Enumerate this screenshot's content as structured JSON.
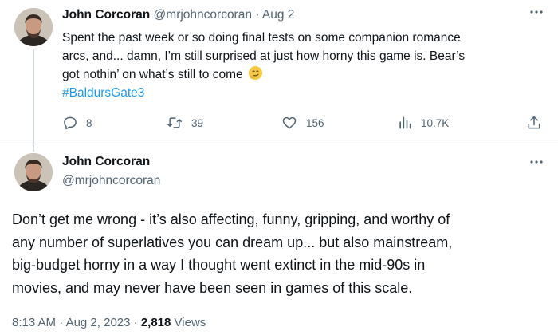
{
  "tweet1": {
    "name": "John Corcoran",
    "handle": "@mrjohncorcoran",
    "separator": "·",
    "date": "Aug 2",
    "text_lines": [
      "Spent the past week or so doing final tests on some companion romance",
      "arcs, and... damn, I’m still surprised at just how horny this game is. Bear’s",
      "got nothin’ on what’s still to come"
    ],
    "emoji": "smirk-emoji",
    "hashtag": "#BaldursGate3",
    "actions": {
      "replies": "8",
      "retweets": "39",
      "likes": "156",
      "views": "10.7K"
    },
    "icons": [
      "reply-icon",
      "retweet-icon",
      "like-icon",
      "views-icon",
      "share-icon",
      "more-icon"
    ]
  },
  "tweet2": {
    "name": "John Corcoran",
    "handle": "@mrjohncorcoran",
    "text_lines": [
      "Don’t get me wrong - it’s also affecting, funny, gripping, and worthy of",
      "any number of superlatives you can dream up... but also mainstream,",
      "big-budget horny in a way I thought went extinct in the mid-90s in",
      "movies, and may never have been seen in games of this scale."
    ],
    "time": "8:13 AM",
    "separator": "·",
    "date": "Aug 2, 2023",
    "views_count": "2,818",
    "views_label": "Views"
  },
  "colors": {
    "text": "#0f1419",
    "muted": "#536471",
    "link": "#1d9bf0",
    "divider": "#eff3f4",
    "thread_line": "#cfd9de"
  }
}
